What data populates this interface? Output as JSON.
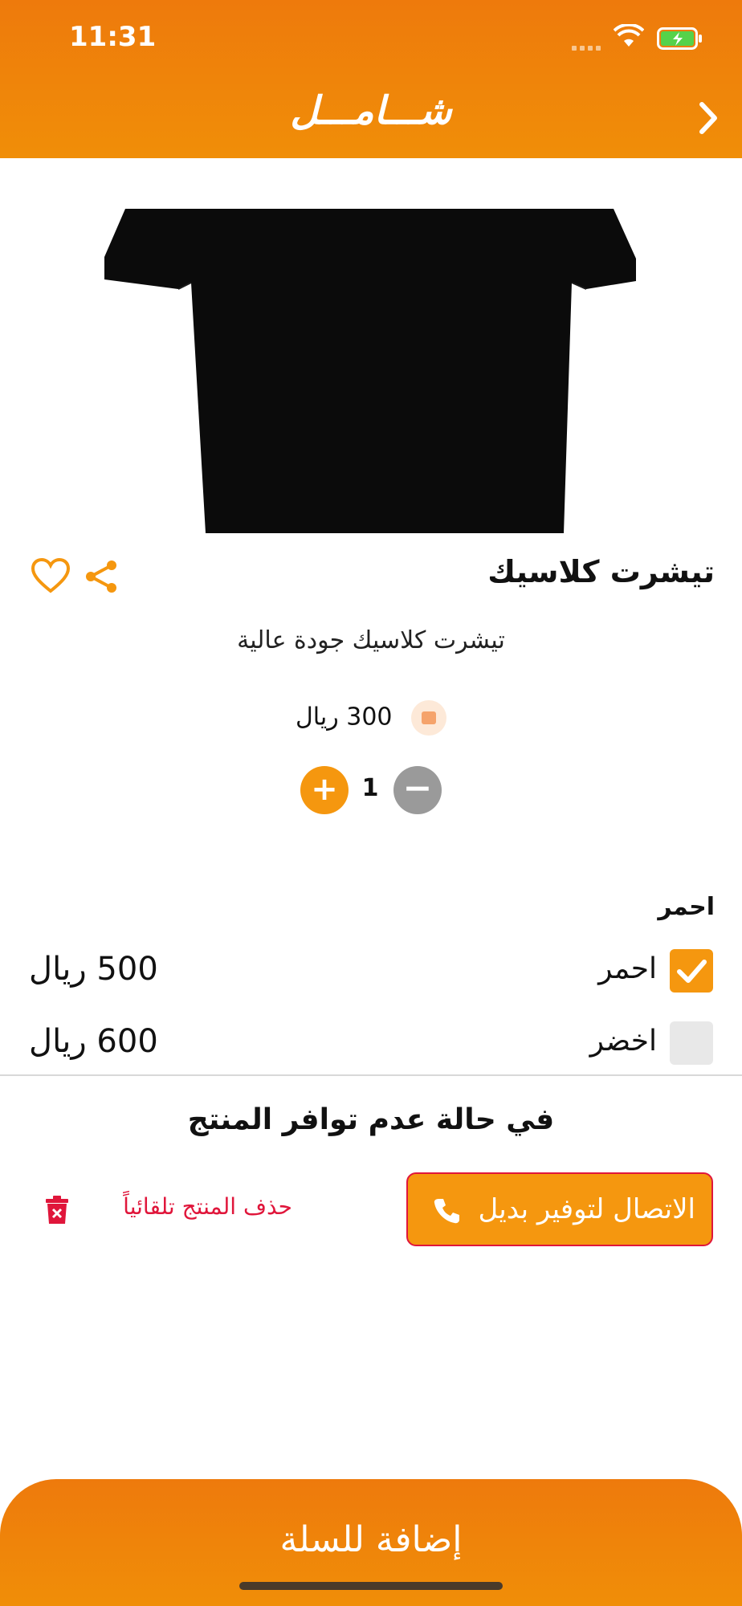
{
  "status_bar": {
    "time": "11:31"
  },
  "header": {
    "brand": "شـــامـــل"
  },
  "product": {
    "title": "تيشرت كلاسيك",
    "description": "تيشرت كلاسيك جودة عالية",
    "price": "300 ريال",
    "quantity": "1",
    "image_color": "#0b0b0b"
  },
  "quantity_controls": {
    "plus": "+",
    "minus": "−"
  },
  "options": {
    "group_title": "احمر",
    "items": [
      {
        "label": "احمر",
        "price": "500 ريال",
        "checked": true
      },
      {
        "label": "اخضر",
        "price": "600 ريال",
        "checked": false
      }
    ]
  },
  "unavailability": {
    "title": "في حالة عدم توافر المنتج",
    "call_button_label": "الاتصال لتوفير بديل",
    "auto_remove_label": "حذف المنتج تلقائياً"
  },
  "cart": {
    "add_label": "إضافة للسلة"
  },
  "colors": {
    "accent": "#f5970f",
    "header": "#ee7a0c",
    "danger": "#e0163b",
    "disabled": "#9a9a9a"
  },
  "icons": [
    "wifi-icon",
    "battery-icon",
    "chevron-right-icon",
    "heart-icon",
    "share-icon",
    "phone-icon",
    "trash-icon",
    "check-icon",
    "coin-icon"
  ]
}
